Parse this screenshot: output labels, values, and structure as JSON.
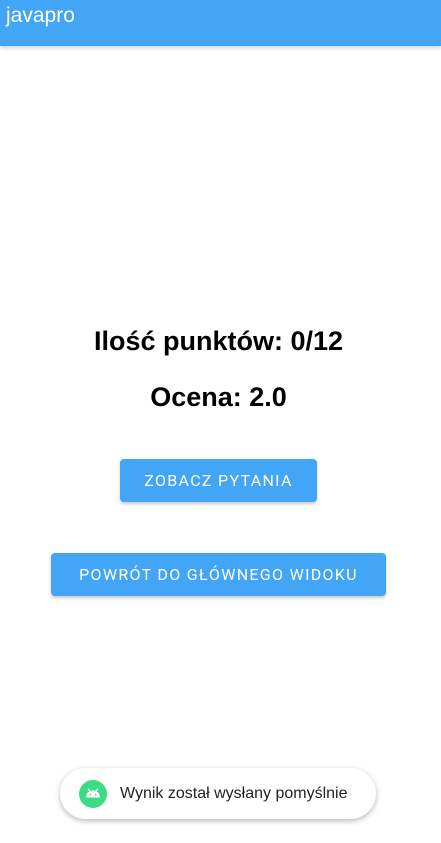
{
  "app_bar": {
    "title": "javapro",
    "color": "#42a5f5"
  },
  "result": {
    "score_text": "Ilość punktów: 0/12",
    "grade_text": "Ocena: 2.0"
  },
  "buttons": {
    "see_questions_label": "ZOBACZ PYTANIA",
    "back_to_main_label": "POWRÓT DO GŁÓWNEGO WIDOKU"
  },
  "toast": {
    "icon": "android-icon",
    "icon_color": "#3ddc84",
    "message": "Wynik został wysłany pomyślnie"
  }
}
